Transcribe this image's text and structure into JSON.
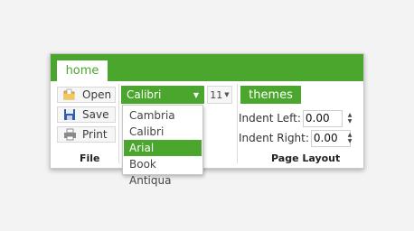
{
  "tabs": {
    "home": "home"
  },
  "file_group": {
    "open_label": "Open",
    "save_label": "Save",
    "print_label": "Print",
    "group_label": "File"
  },
  "font_group": {
    "font_value": "Calibri",
    "size_value": "11",
    "options": [
      "Cambria",
      "Calibri",
      "Arial",
      "Book Antiqua"
    ],
    "highlighted_option": "Arial"
  },
  "page_layout_group": {
    "themes_label": "themes",
    "indent_left_label": "Indent Left:",
    "indent_left_value": "0.00",
    "indent_right_label": "Indent Right:",
    "indent_right_value": "0.00",
    "group_label": "Page Layout"
  },
  "colors": {
    "accent": "#4aa62d",
    "background": "#f3f3f3"
  },
  "icons": [
    "open-folder-icon",
    "save-disk-icon",
    "print-icon",
    "chevron-down-icon",
    "spin-up-icon",
    "spin-down-icon"
  ]
}
